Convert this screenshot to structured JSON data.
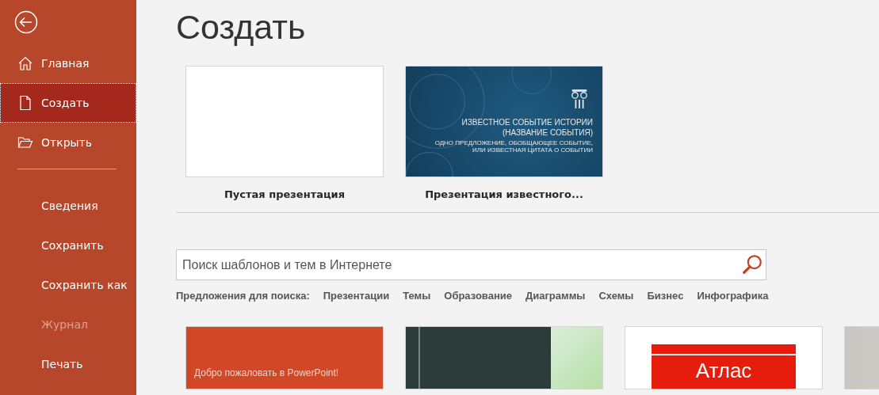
{
  "sidebar": {
    "main_items": [
      {
        "label": "Главная",
        "selected": false,
        "disabled": false
      },
      {
        "label": "Создать",
        "selected": true,
        "disabled": false
      },
      {
        "label": "Открыть",
        "selected": false,
        "disabled": false
      }
    ],
    "file_items": [
      {
        "label": "Сведения",
        "selected": false,
        "disabled": false
      },
      {
        "label": "Сохранить",
        "selected": false,
        "disabled": false
      },
      {
        "label": "Сохранить как",
        "selected": false,
        "disabled": false
      },
      {
        "label": "Журнал",
        "selected": false,
        "disabled": true
      },
      {
        "label": "Печать",
        "selected": false,
        "disabled": false
      }
    ]
  },
  "page_title": "Создать",
  "featured": [
    {
      "kind": "blank",
      "label": "Пустая презентация"
    },
    {
      "kind": "history",
      "label": "Презентация известного...",
      "slide_title": "ИЗВЕСТНОЕ СОБЫТИЕ ИСТОРИИ",
      "slide_subtitle": "(НАЗВАНИЕ СОБЫТИЯ)",
      "slide_caption": "ОДНО ПРЕДЛОЖЕНИЕ, ОБОБЩАЮЩЕЕ СОБЫТИЕ, ИЛИ ИЗВЕСТНАЯ ЦИТАТА О СОБЫТИИ"
    }
  ],
  "search": {
    "placeholder": "Поиск шаблонов и тем в Интернете"
  },
  "suggestions": {
    "label": "Предложения для поиска:",
    "items": [
      "Презентации",
      "Темы",
      "Образование",
      "Диаграммы",
      "Схемы",
      "Бизнес",
      "Инфографика"
    ]
  },
  "templates": [
    {
      "kind": "welcome",
      "slide_text": "Добро пожаловать в PowerPoint!"
    },
    {
      "kind": "dark"
    },
    {
      "kind": "atlas",
      "slide_text": "Атлас"
    },
    {
      "kind": "grey"
    }
  ]
}
